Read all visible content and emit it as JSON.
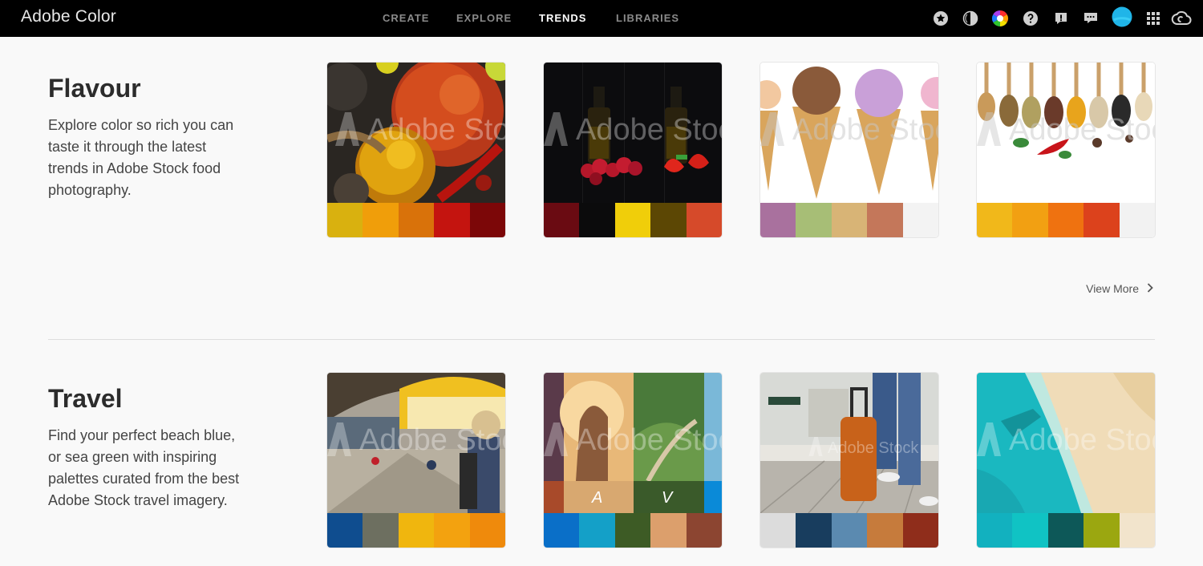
{
  "app": {
    "title": "Adobe Color"
  },
  "nav": {
    "items": [
      {
        "label": "CREATE"
      },
      {
        "label": "EXPLORE"
      },
      {
        "label": "TRENDS"
      },
      {
        "label": "LIBRARIES"
      }
    ],
    "active": "TRENDS"
  },
  "toolbar_icons": [
    "star-icon",
    "contrast-icon",
    "color-wheel-icon",
    "help-icon",
    "feedback-icon",
    "chat-icon",
    "avatar",
    "apps-grid-icon",
    "creative-cloud-icon"
  ],
  "watermark_text": "Adobe Stock",
  "sections": [
    {
      "title": "Flavour",
      "description": "Explore color so rich you can taste it through the latest trends in Adobe Stock food photography.",
      "view_more": "View More",
      "cards": [
        {
          "palette": [
            "#d9b10f",
            "#f09e0a",
            "#d9720a",
            "#c4140f",
            "#7c0708"
          ]
        },
        {
          "palette": [
            "#6a0b12",
            "#0b0b0c",
            "#f0ce0a",
            "#5c4704",
            "#d64a2a"
          ]
        },
        {
          "palette": [
            "#a9719e",
            "#a7be76",
            "#d8b476",
            "#c4775a",
            "#f3f3f3"
          ]
        },
        {
          "palette": [
            "#f1b81a",
            "#f2a012",
            "#ef7210",
            "#dc421c",
            "#f2f2f2"
          ]
        }
      ]
    },
    {
      "title": "Travel",
      "description": "Find your perfect beach blue, or sea green with inspiring palettes curated from the best Adobe Stock travel imagery.",
      "cards": [
        {
          "palette": [
            "#0f4d8f",
            "#6d6f60",
            "#f0b60e",
            "#f3a20f",
            "#ef8a0c"
          ]
        },
        {
          "palette": [
            "#0a6fc8",
            "#14a0c8",
            "#3d5b25",
            "#dc9f6c",
            "#8c4531"
          ],
          "letters": [
            "A",
            "V"
          ]
        },
        {
          "palette": [
            "#dcdcdc",
            "#183d5e",
            "#5b8ab0",
            "#c67b3c",
            "#8f2d1b"
          ]
        },
        {
          "palette": [
            "#12b1bf",
            "#10c3c4",
            "#0d5858",
            "#9ba710",
            "#f2e4cc"
          ]
        }
      ]
    }
  ]
}
